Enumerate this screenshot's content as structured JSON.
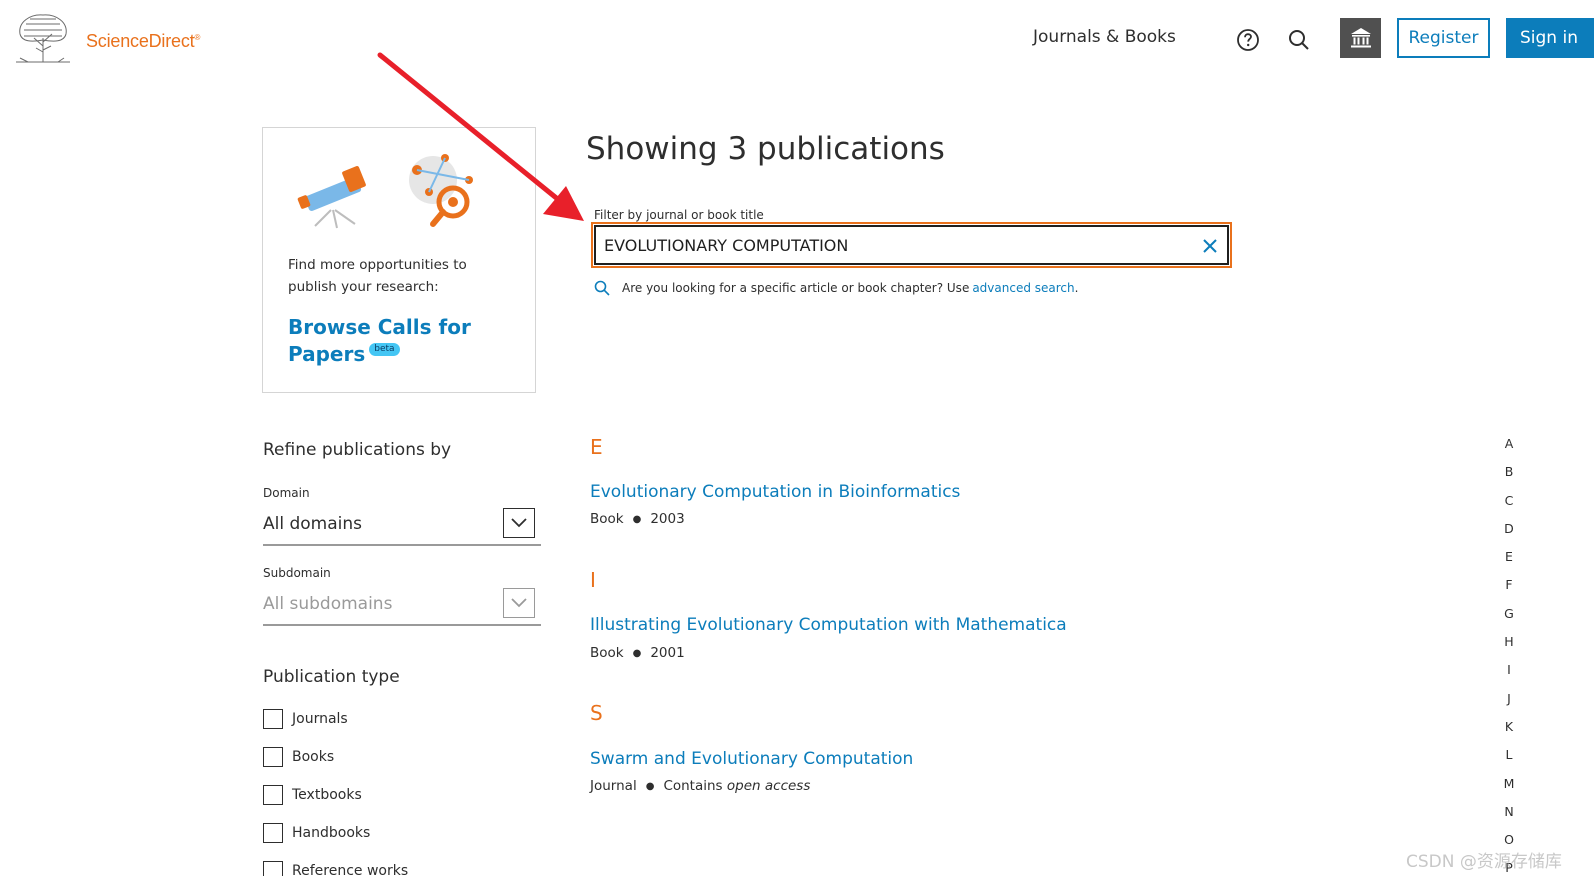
{
  "header": {
    "brand": "ScienceDirect",
    "brand_mark": "®",
    "nav_journals_books": "Journals & Books",
    "register_label": "Register",
    "signin_label": "Sign in",
    "icons": [
      "tree-logo-icon",
      "help-icon",
      "search-icon",
      "institution-icon"
    ]
  },
  "promo": {
    "text": "Find more opportunities to publish your research:",
    "link": "Browse Calls for Papers",
    "badge": "beta",
    "icons": [
      "telescope-icon",
      "network-target-icon"
    ]
  },
  "main": {
    "title": "Showing 3 publications",
    "filter_label": "Filter by journal or book title",
    "filter_value": "EVOLUTIONARY COMPUTATION",
    "hint_text": "Are you looking for a specific article or book chapter? Use",
    "hint_link": "advanced search",
    "hint_end": "."
  },
  "sidebar": {
    "refine_title": "Refine publications by",
    "domain_label": "Domain",
    "domain_value": "All domains",
    "subdomain_label": "Subdomain",
    "subdomain_value": "All subdomains",
    "pubtype_title": "Publication type",
    "pubtypes": [
      "Journals",
      "Books",
      "Textbooks",
      "Handbooks",
      "Reference works"
    ]
  },
  "results": [
    {
      "letter": "E",
      "title": "Evolutionary Computation in Bioinformatics",
      "type": "Book",
      "extra": "2003"
    },
    {
      "letter": "I",
      "title": "Illustrating Evolutionary Computation with Mathematica",
      "type": "Book",
      "extra": "2001"
    },
    {
      "letter": "S",
      "title": "Swarm and Evolutionary Computation",
      "type": "Journal",
      "extra_prefix": "Contains",
      "extra_em": "open access"
    }
  ],
  "alphabet": [
    "A",
    "B",
    "C",
    "D",
    "E",
    "F",
    "G",
    "H",
    "I",
    "J",
    "K",
    "L",
    "M",
    "N",
    "O",
    "P"
  ],
  "watermark": "CSDN @资源存储库",
  "colors": {
    "brand_orange": "#e9711c",
    "link_blue": "#0c7dbb",
    "annotation_red": "#e8202a"
  }
}
